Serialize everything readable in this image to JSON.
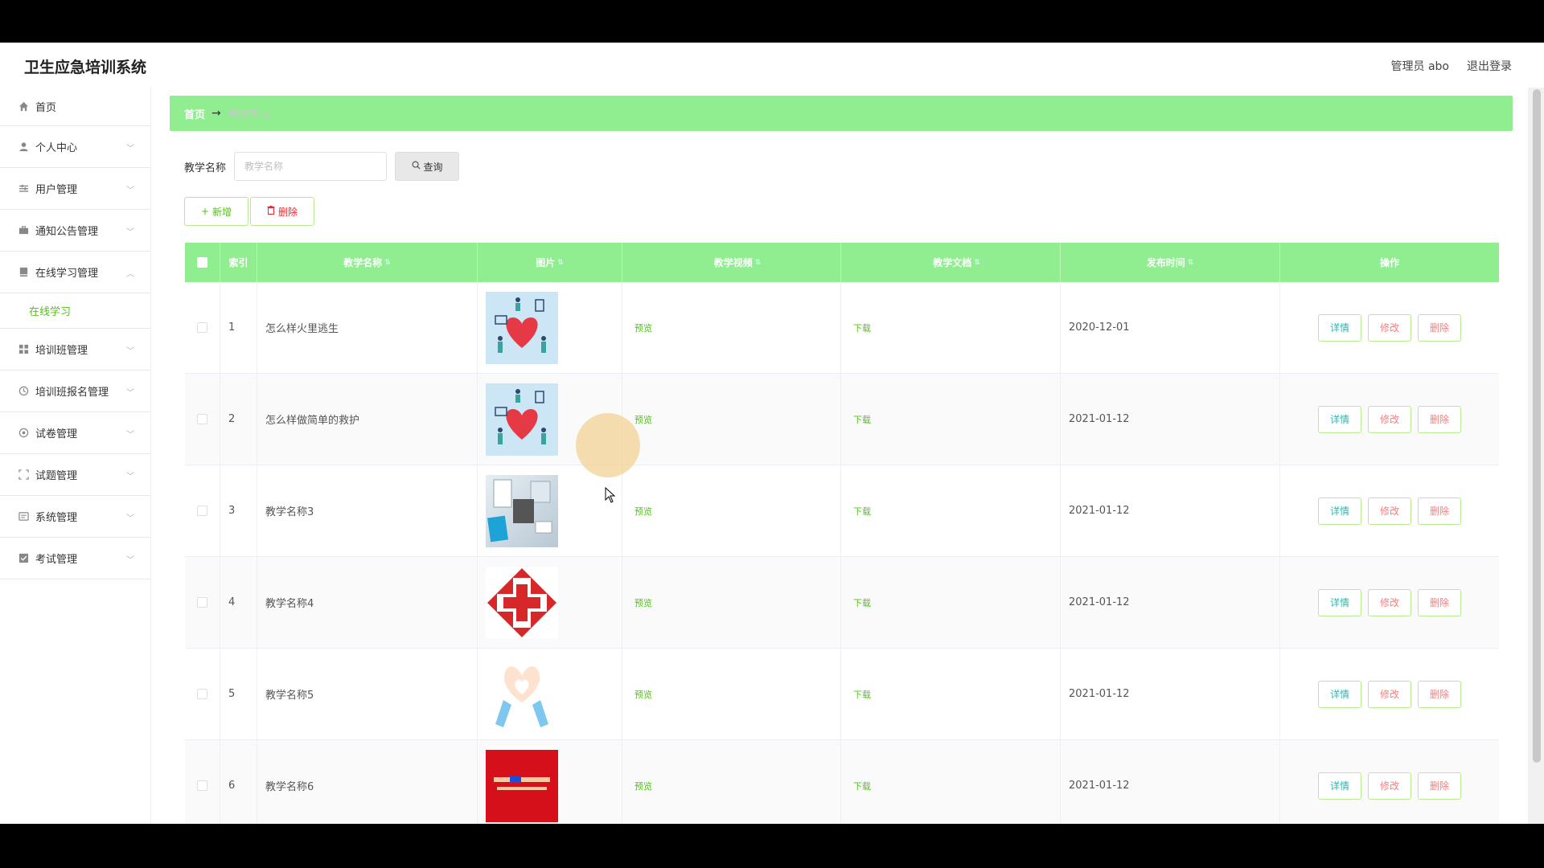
{
  "app": {
    "title": "卫生应急培训系统",
    "user_label": "管理员 abo",
    "logout_label": "退出登录"
  },
  "sidebar": {
    "items": [
      {
        "label": "首页",
        "icon": "home-icon"
      },
      {
        "label": "个人中心",
        "icon": "user-icon"
      },
      {
        "label": "用户管理",
        "icon": "sliders-icon"
      },
      {
        "label": "通知公告管理",
        "icon": "briefcase-icon"
      },
      {
        "label": "在线学习管理",
        "icon": "book-icon"
      },
      {
        "label": "培训班管理",
        "icon": "grid-icon"
      },
      {
        "label": "培训班报名管理",
        "icon": "clock-icon"
      },
      {
        "label": "试卷管理",
        "icon": "settings-icon"
      },
      {
        "label": "试题管理",
        "icon": "frame-icon"
      },
      {
        "label": "系统管理",
        "icon": "message-icon"
      },
      {
        "label": "考试管理",
        "icon": "checkbox-icon"
      }
    ],
    "active_sub": "在线学习"
  },
  "breadcrumb": {
    "home": "首页",
    "arrow": "→",
    "current": "在线学习"
  },
  "search": {
    "label": "教学名称",
    "placeholder": "教学名称",
    "query_label": "查询"
  },
  "actions": {
    "add_label": "新增",
    "delete_label": "删除"
  },
  "table": {
    "columns": [
      "索引",
      "教学名称",
      "图片",
      "教学视频",
      "教学文档",
      "发布时间",
      "操作"
    ],
    "preview_label": "预览",
    "download_label": "下载",
    "op_detail": "详情",
    "op_edit": "修改",
    "op_delete": "删除",
    "rows": [
      {
        "index": "1",
        "name": "怎么样火里逃生",
        "image": "hearts-illustration",
        "date": "2020-12-01"
      },
      {
        "index": "2",
        "name": "怎么样做简单的救护",
        "image": "hearts-illustration",
        "date": "2021-01-12"
      },
      {
        "index": "3",
        "name": "教学名称3",
        "image": "office-desk-photo",
        "date": "2021-01-12"
      },
      {
        "index": "4",
        "name": "教学名称4",
        "image": "red-cross-logo",
        "date": "2021-01-12"
      },
      {
        "index": "5",
        "name": "教学名称5",
        "image": "heart-hands-illustration",
        "date": "2021-01-12"
      },
      {
        "index": "6",
        "name": "教学名称6",
        "image": "red-poster",
        "date": "2021-01-12"
      }
    ]
  },
  "colors": {
    "accent_green": "#90ee90",
    "link_green": "#52c41a",
    "danger": "#f08080"
  }
}
